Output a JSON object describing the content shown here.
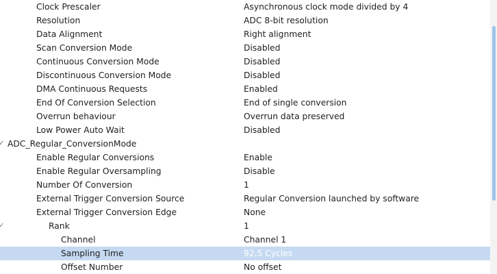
{
  "rows": [
    {
      "label": "Clock Prescaler",
      "value": "Asynchronous clock mode divided by 4"
    },
    {
      "label": "Resolution",
      "value": "ADC 8-bit resolution"
    },
    {
      "label": "Data Alignment",
      "value": "Right alignment"
    },
    {
      "label": "Scan Conversion Mode",
      "value": "Disabled"
    },
    {
      "label": "Continuous Conversion Mode",
      "value": "Disabled"
    },
    {
      "label": "Discontinuous Conversion Mode",
      "value": "Disabled"
    },
    {
      "label": "DMA Continuous Requests",
      "value": "Enabled"
    },
    {
      "label": "End Of Conversion Selection",
      "value": "End of single conversion"
    },
    {
      "label": "Overrun behaviour",
      "value": "Overrun data preserved"
    },
    {
      "label": "Low Power Auto Wait",
      "value": "Disabled"
    },
    {
      "label": "ADC_Regular_ConversionMode",
      "value": ""
    },
    {
      "label": "Enable Regular Conversions",
      "value": "Enable"
    },
    {
      "label": "Enable Regular Oversampling",
      "value": "Disable"
    },
    {
      "label": "Number Of Conversion",
      "value": "1"
    },
    {
      "label": "External Trigger Conversion Source",
      "value": "Regular Conversion launched by software"
    },
    {
      "label": "External Trigger Conversion Edge",
      "value": "None"
    },
    {
      "label": "Rank",
      "value": "1"
    },
    {
      "label": "Channel",
      "value": "Channel 1"
    },
    {
      "label": "Sampling Time",
      "value": "92.5 Cycles"
    },
    {
      "label": "Offset Number",
      "value": "No offset"
    }
  ],
  "icons": {
    "expanded": "chevron-down-icon",
    "glyph": "✓"
  }
}
